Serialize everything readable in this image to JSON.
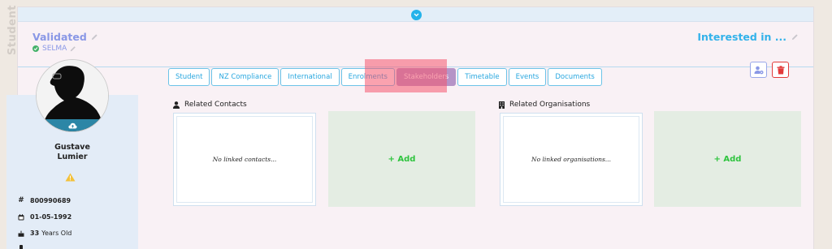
{
  "side_label": "Student",
  "header": {
    "status": "Validated",
    "sub_status": "SELMA",
    "interest": "Interested in ..."
  },
  "profile": {
    "first_name": "Gustave",
    "last_name": "Lumier",
    "id_number": "800990689",
    "dob": "01-05-1992",
    "age_number": "33",
    "age_suffix": "Years Old"
  },
  "tabs": [
    "Student",
    "NZ Compliance",
    "International",
    "Enrolments",
    "Stakeholders",
    "Timetable",
    "Events",
    "Documents"
  ],
  "active_tab": "Stakeholders",
  "sections": {
    "contacts_title": "Related Contacts",
    "contacts_empty": "No linked contacts...",
    "orgs_title": "Related Organisations",
    "orgs_empty": "No linked organisations...",
    "add_label": "+ Add"
  },
  "colors": {
    "accent_blue": "#29a7df",
    "status_purple": "#8a98e6",
    "active_tab": "#b594c7",
    "add_green": "#2ec43e",
    "highlight": "#f5556e"
  }
}
